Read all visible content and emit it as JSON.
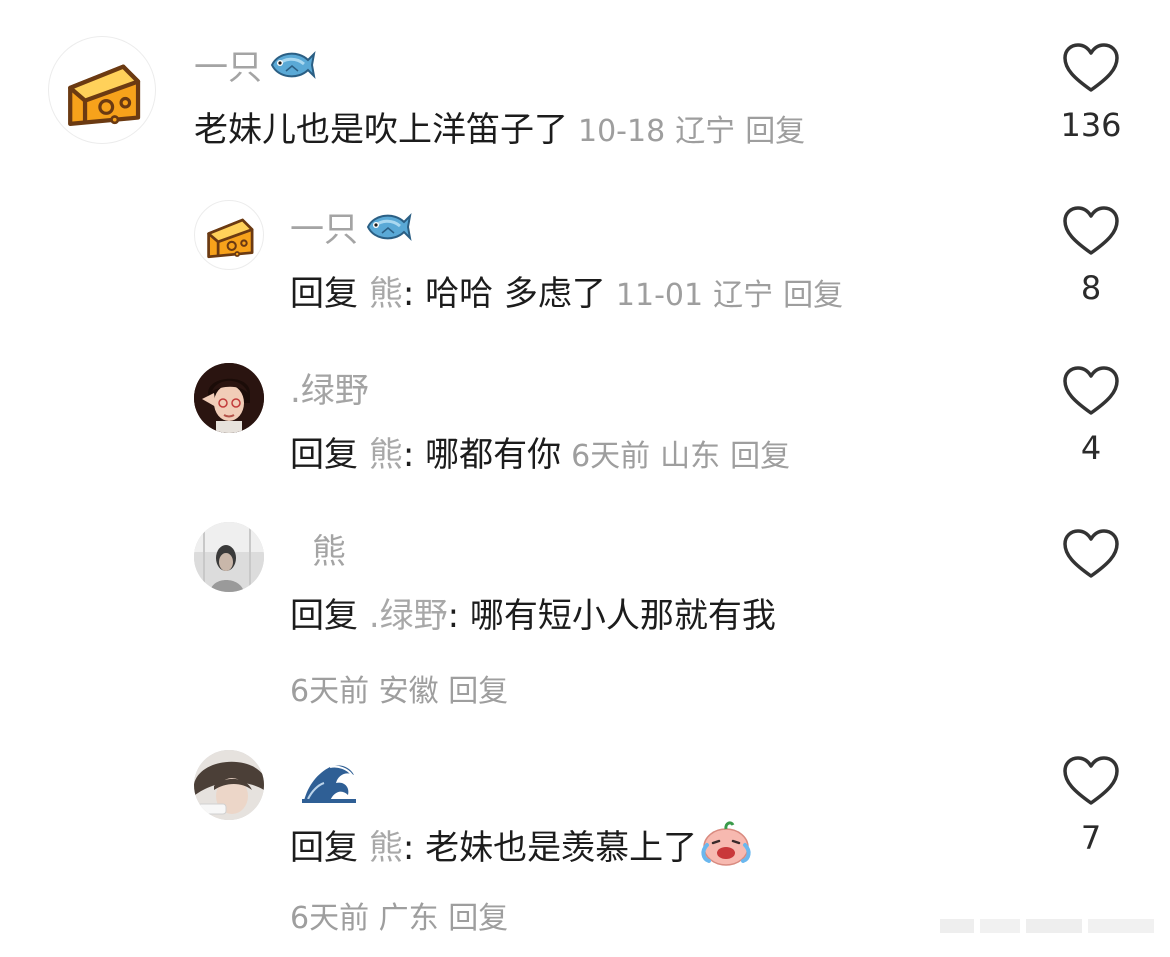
{
  "comments": [
    {
      "username": "一只",
      "text": "老妹儿也是吹上洋笛子了",
      "date": "10-18",
      "location": "辽宁",
      "reply_label": "回复",
      "likes": "136"
    },
    {
      "username": "一只",
      "reply_prefix": "回复",
      "reply_to": "熊",
      "text": ": 哈哈 多虑了",
      "date": "11-01",
      "location": "辽宁",
      "reply_label": "回复",
      "likes": "8"
    },
    {
      "username": ".绿野",
      "reply_prefix": "回复",
      "reply_to": "熊",
      "text": ": 哪都有你",
      "date": "6天前",
      "location": "山东",
      "reply_label": "回复",
      "likes": "4"
    },
    {
      "username": "熊",
      "reply_prefix": "回复",
      "reply_to": ".绿野",
      "text": ": 哪有短小人那就有我",
      "date": "6天前",
      "location": "安徽",
      "reply_label": "回复",
      "likes": ""
    },
    {
      "username": "",
      "reply_prefix": "回复",
      "reply_to": "熊",
      "text": ": 老妹也是羡慕上了",
      "date": "6天前",
      "location": "广东",
      "reply_label": "回复",
      "likes": "7"
    }
  ],
  "icons": {
    "fish": "fish-emoji-icon",
    "wave": "wave-emoji-icon",
    "heart": "heart-outline-icon",
    "sticker": "laughing-cry-sticker-icon",
    "cheese": "cheese-avatar-icon"
  },
  "colors": {
    "text": "#1c1c1c",
    "muted": "#9e9e9e",
    "username": "#a4a4a4",
    "heart_stroke": "#333333"
  }
}
